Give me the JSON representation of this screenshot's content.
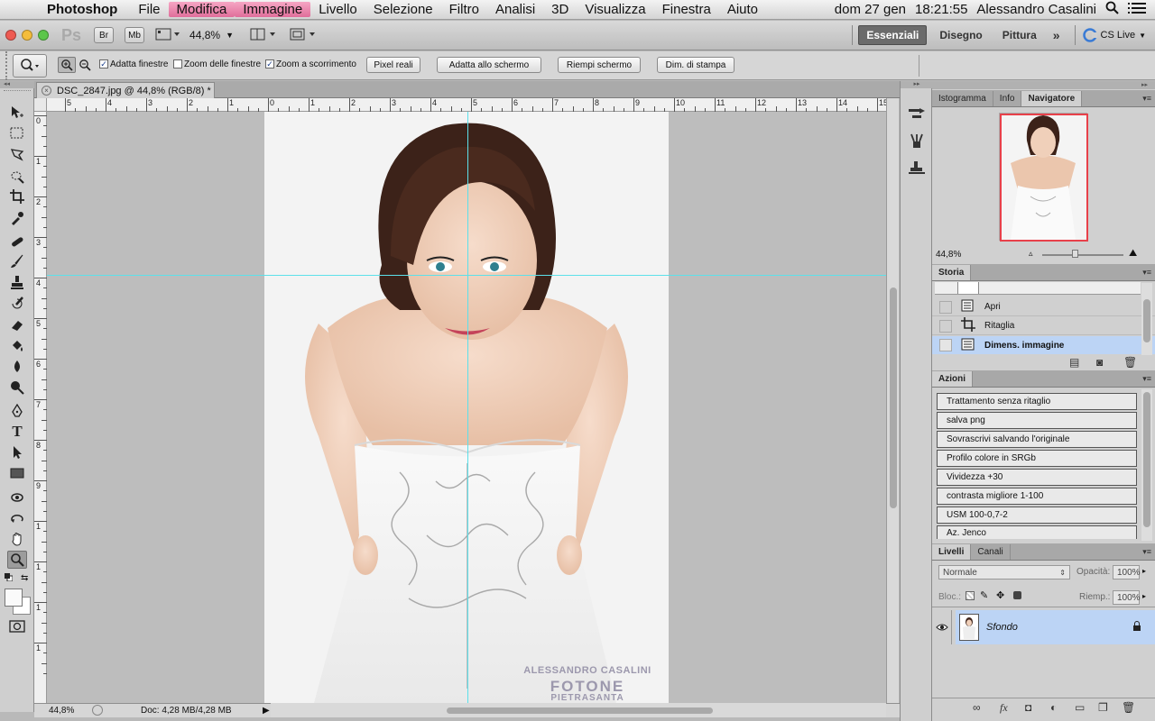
{
  "menubar": {
    "app_name": "Photoshop",
    "items": [
      "File",
      "Modifica",
      "Immagine",
      "Livello",
      "Selezione",
      "Filtro",
      "Analisi",
      "3D",
      "Visualizza",
      "Finestra",
      "Aiuto"
    ],
    "date": "dom 27 gen",
    "time": "18:21:55",
    "user": "Alessandro Casalini"
  },
  "appbar": {
    "ps_logo": "Ps",
    "bridge_label": "Br",
    "minibridge_label": "Mb",
    "zoom_value": "44,8%",
    "workspaces": [
      "Essenziali",
      "Disegno",
      "Pittura"
    ],
    "more": "»",
    "cs_live": "CS Live"
  },
  "options": {
    "adatta_finestre": "Adatta finestre",
    "zoom_finestre": "Zoom delle finestre",
    "zoom_scorrimento": "Zoom a scorrimento",
    "pixel_reali": "Pixel reali",
    "adatta_schermo": "Adatta allo schermo",
    "riempi_schermo": "Riempi schermo",
    "dim_stampa": "Dim. di stampa"
  },
  "document": {
    "tab_title": "DSC_2847.jpg @ 44,8% (RGB/8) *",
    "ruler_top": [
      "5",
      "4",
      "3",
      "2",
      "1",
      "0",
      "1",
      "2",
      "3",
      "4",
      "5",
      "6",
      "7",
      "8",
      "9",
      "10",
      "11",
      "12",
      "13",
      "14",
      "15"
    ],
    "ruler_left": [
      "0",
      "1",
      "2",
      "3",
      "4",
      "5",
      "6",
      "7",
      "8",
      "9",
      "1",
      "1",
      "1",
      "1"
    ],
    "watermark_line1": "ALESSANDRO CASALINI",
    "watermark_line2": "FOTONE",
    "watermark_line3": "PIETRASANTA"
  },
  "status": {
    "zoom": "44,8%",
    "doc": "Doc: 4,28 MB/4,28 MB"
  },
  "navigator": {
    "tabs": [
      "Istogramma",
      "Info",
      "Navigatore"
    ],
    "zoom": "44,8%"
  },
  "history": {
    "tab": "Storia",
    "items": [
      "Apri",
      "Ritaglia",
      "Dimens. immagine"
    ]
  },
  "actions": {
    "tab": "Azioni",
    "items": [
      "Trattamento senza ritaglio",
      "salva png",
      "Sovrascrivi salvando l'originale",
      "Profilo colore in SRGb",
      "Vividezza +30",
      "contrasta migliore 1-100",
      "USM 100-0,7-2",
      "Az. Jenco"
    ]
  },
  "layers": {
    "tabs": [
      "Livelli",
      "Canali"
    ],
    "blend_mode": "Normale",
    "opacity_label": "Opacità:",
    "opacity": "100%",
    "lock_label": "Bloc.:",
    "fill_label": "Riemp.:",
    "fill": "100%",
    "layer_name": "Sfondo"
  },
  "colors": {
    "guide": "#5ce0ea",
    "selection": "#bcd4f5",
    "nav_box": "#e8404a"
  }
}
